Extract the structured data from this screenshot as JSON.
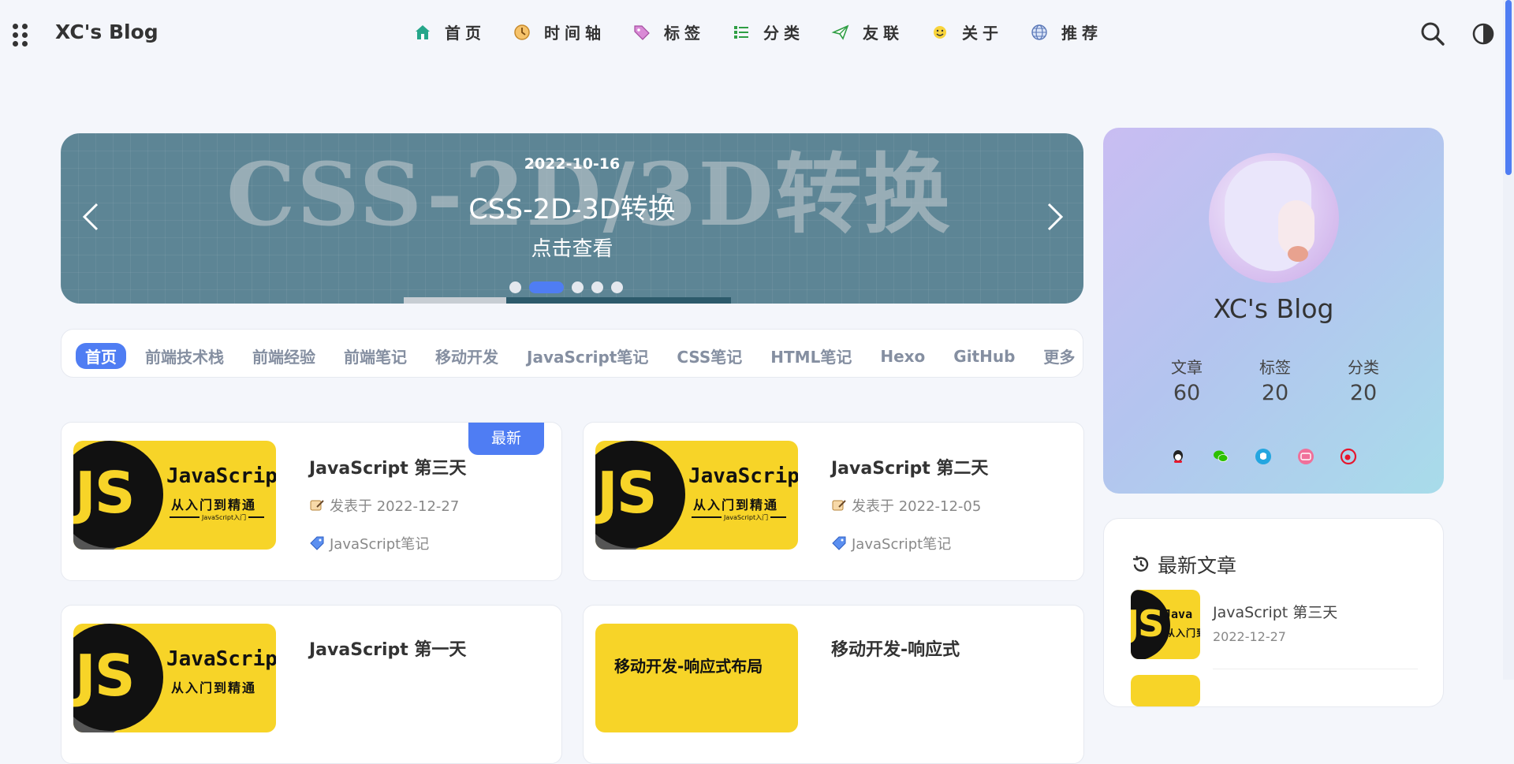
{
  "site": {
    "brand": "XC's Blog"
  },
  "nav": [
    {
      "label": "首页",
      "icon": "home-icon"
    },
    {
      "label": "时间轴",
      "icon": "clock-icon"
    },
    {
      "label": "标签",
      "icon": "tag-icon"
    },
    {
      "label": "分类",
      "icon": "list-icon"
    },
    {
      "label": "友联",
      "icon": "paper-plane-icon"
    },
    {
      "label": "关于",
      "icon": "smiley-icon"
    },
    {
      "label": "推荐",
      "icon": "globe-icon"
    }
  ],
  "banner": {
    "bg_text": "CSS-2D/3D转换",
    "date": "2022-10-16",
    "title": "CSS-2D-3D转换",
    "cta": "点击查看",
    "slide_count": 5,
    "active_slide": 2
  },
  "categories": [
    "首页",
    "前端技术栈",
    "前端经验",
    "前端笔记",
    "移动开发",
    "JavaScript笔记",
    "CSS笔记",
    "HTML笔记",
    "Hexo",
    "GitHub",
    "更多"
  ],
  "posts": [
    {
      "title": "JavaScript 第三天",
      "date": "发表于 2022-12-27",
      "category": "JavaScript笔记",
      "badge": "最新",
      "thumb": "js",
      "thumb_word": "JavaScript",
      "thumb_sub": "从入门到精通",
      "thumb_tiny": "JavaScript入门"
    },
    {
      "title": "JavaScript 第二天",
      "date": "发表于 2022-12-05",
      "category": "JavaScript笔记",
      "thumb": "js",
      "thumb_word": "JavaScript",
      "thumb_sub": "从入门到精通",
      "thumb_tiny": "JavaScript入门"
    },
    {
      "title": "JavaScript 第一天",
      "thumb": "js",
      "thumb_word": "JavaScript",
      "thumb_sub": "从入门到精通"
    },
    {
      "title": "移动开发-响应式",
      "thumb": "mobile",
      "thumb_word": "移动开发-响应式布局"
    }
  ],
  "js_letters": "JS",
  "profile": {
    "name": "XC's Blog",
    "stats": [
      {
        "label": "文章",
        "value": "60"
      },
      {
        "label": "标签",
        "value": "20"
      },
      {
        "label": "分类",
        "value": "20"
      }
    ],
    "socials": [
      {
        "icon": "qq-icon",
        "color": "#222222"
      },
      {
        "icon": "wechat-icon",
        "color": "#2dc100"
      },
      {
        "icon": "github-icon",
        "color": "#24a6e0"
      },
      {
        "icon": "bilibili-icon",
        "color": "#f0709a"
      },
      {
        "icon": "weibo-icon",
        "color": "#e6162d"
      }
    ]
  },
  "recent": {
    "heading": "最新文章",
    "items": [
      {
        "title": "JavaScript 第三天",
        "date": "2022-12-27",
        "thumb_word": "Java",
        "thumb_sub": "从入门到"
      }
    ]
  },
  "colors": {
    "accent": "#4f7df3",
    "background": "#f4f6fb"
  }
}
